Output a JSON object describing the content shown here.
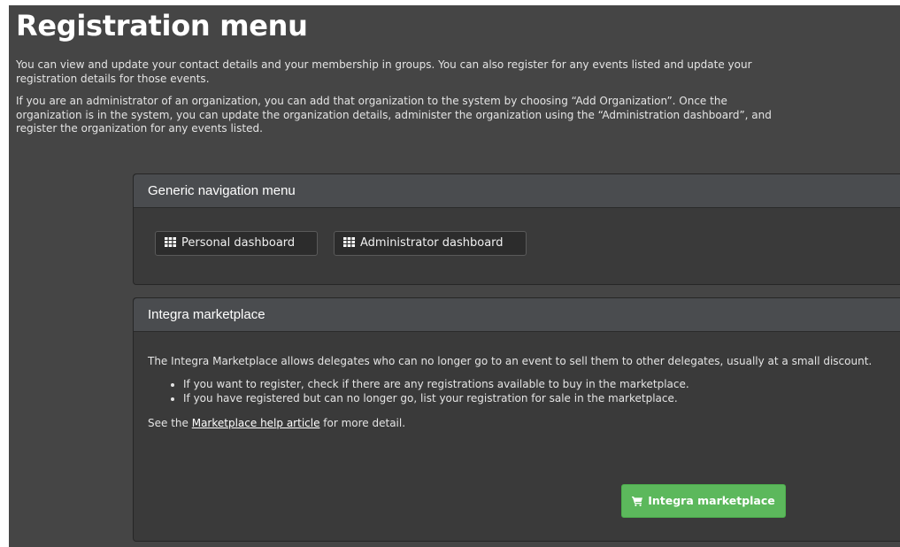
{
  "page": {
    "title": "Registration menu",
    "intro_1": "You can view and update your contact details and your membership in groups. You can also register for any events listed and update your registration details for those events.",
    "intro_2": "If you are an administrator of an organization, you can add that organization to the system by choosing “Add Organization”. Once the organization is in the system, you can update the organization details, administer the organization using the “Administration dashboard”, and register the organization for any events listed."
  },
  "nav_panel": {
    "heading": "Generic navigation menu",
    "personal_label": "Personal dashboard",
    "admin_label": "Administrator dashboard",
    "icon": "grid-icon"
  },
  "market_panel": {
    "heading": "Integra marketplace",
    "description": "The Integra Marketplace allows delegates who can no longer go to an event to sell them to other delegates, usually at a small discount.",
    "bullets": [
      "If you want to register, check if there are any registrations available to buy in the marketplace.",
      "If you have registered but can no longer go, list your registration for sale in the marketplace."
    ],
    "see_prefix": "See the ",
    "help_link": "Marketplace help article",
    "see_suffix": " for more detail.",
    "button_label": "Integra marketplace",
    "button_icon": "shopping-cart-icon",
    "button_color": "#5cb85c"
  }
}
